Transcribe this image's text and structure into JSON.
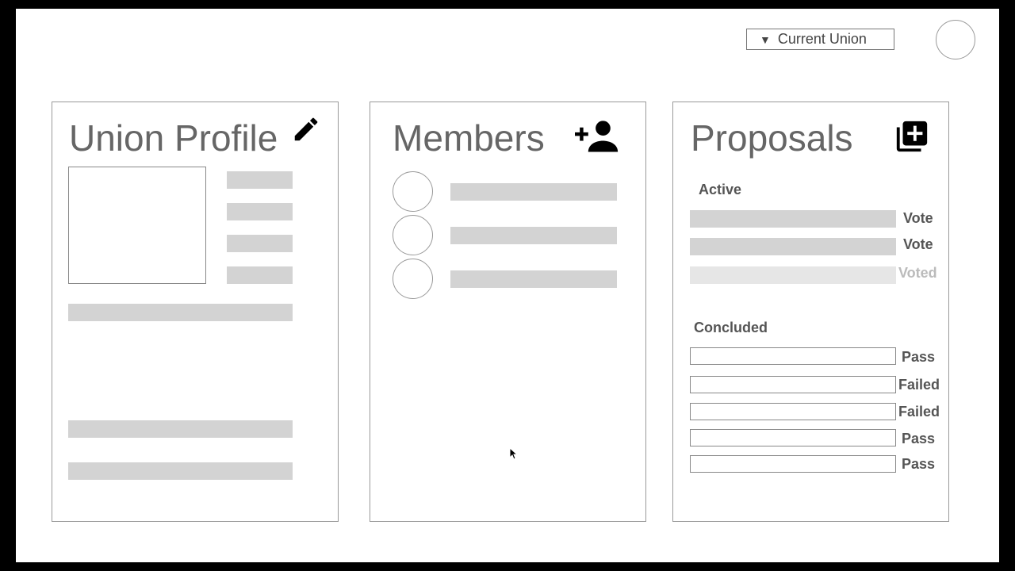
{
  "header": {
    "union_selector": {
      "arrow": "▼",
      "label": "Current Union"
    },
    "avatar_icon": "user-avatar"
  },
  "union_profile": {
    "title": "Union Profile",
    "edit_icon": "pencil-icon"
  },
  "members": {
    "title": "Members",
    "add_icon": "add-person-icon"
  },
  "proposals": {
    "title": "Proposals",
    "add_icon": "add-box-icon",
    "active_label": "Active",
    "active": [
      {
        "action": "Vote"
      },
      {
        "action": "Vote"
      },
      {
        "action": "Voted"
      }
    ],
    "concluded_label": "Concluded",
    "concluded": [
      {
        "status": "Pass"
      },
      {
        "status": "Failed"
      },
      {
        "status": "Failed"
      },
      {
        "status": "Pass"
      },
      {
        "status": "Pass"
      }
    ]
  }
}
